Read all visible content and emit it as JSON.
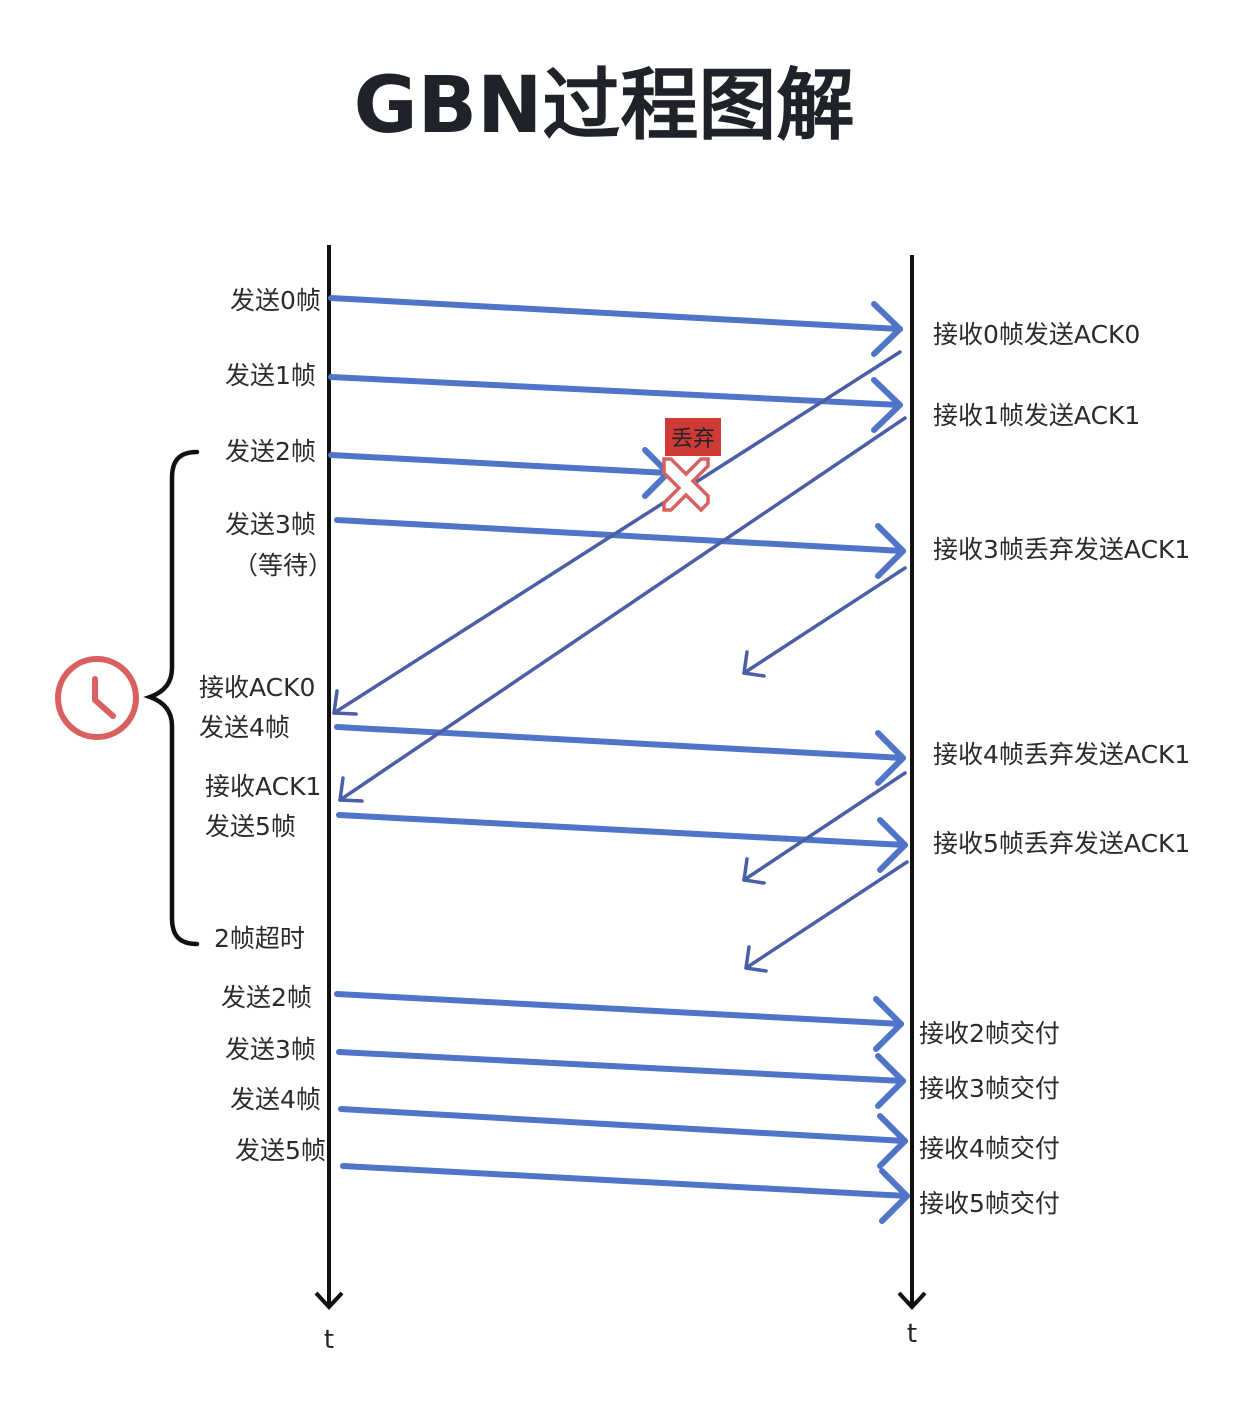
{
  "title": "GBN过程图解",
  "sender_labels": [
    "发送0帧",
    "发送1帧",
    "发送2帧",
    "发送3帧",
    "（等待）",
    "接收ACK0",
    "发送4帧",
    "接收ACK1",
    "发送5帧",
    "2帧超时",
    "发送2帧",
    "发送3帧",
    "发送4帧",
    "发送5帧"
  ],
  "receiver_labels": [
    "接收0帧发送ACK0",
    "接收1帧发送ACK1",
    "接收3帧丢弃发送ACK1",
    "接收4帧丢弃发送ACK1",
    "接收5帧丢弃发送ACK1",
    "接收2帧交付",
    "接收3帧交付",
    "接收4帧交付",
    "接收5帧交付"
  ],
  "drop_label": "丢弃",
  "time_labels": [
    "t",
    "t"
  ],
  "icons": {
    "timer": "clock-icon",
    "lost": "cross-icon"
  },
  "colors": {
    "frame_arrow": "#4f74c8",
    "ack_arrow": "#4a5fa5",
    "timer": "#d9605e",
    "drop_badge": "#cf3a37",
    "axis": "#111111"
  }
}
